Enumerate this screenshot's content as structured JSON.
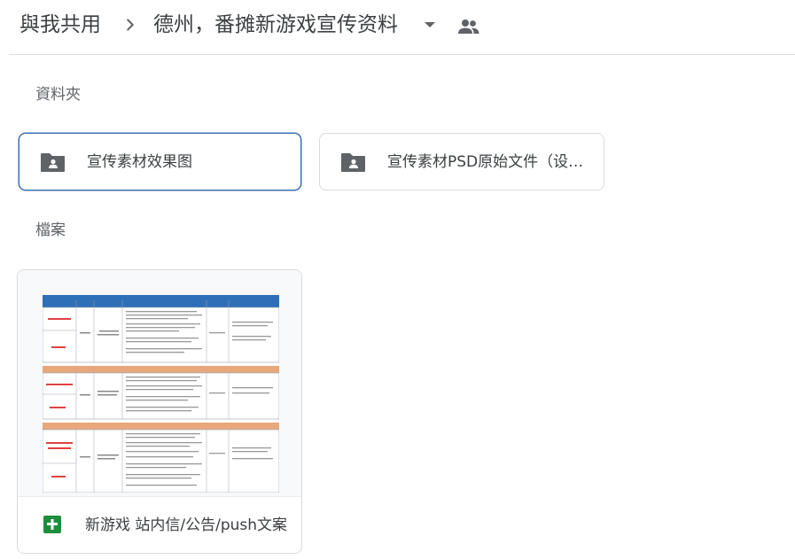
{
  "breadcrumb": {
    "root": "與我共用",
    "current": "德州，番摊新游戏宣传资料"
  },
  "icons": {
    "separator": "chevron-right-icon",
    "caret": "caret-down-icon",
    "shared": "people-icon",
    "folder": "shared-folder-icon",
    "file": "google-sheets-icon"
  },
  "sections": {
    "folders_label": "資料夾",
    "files_label": "檔案"
  },
  "folders": [
    {
      "name": "宣传素材效果图",
      "selected": true
    },
    {
      "name": "宣传素材PSD原始文件（设计师专用）",
      "selected": false
    }
  ],
  "files": [
    {
      "name": "新游戏 站内信/公告/push文案",
      "type": "spreadsheet"
    }
  ],
  "colors": {
    "selected_border": "#3b6fb0",
    "sheet_blue_header": "#2f6fb7",
    "sheet_orange_header": "#e8a87c",
    "sheets_green": "#1e8e3e",
    "icon_gray": "#5f6368"
  }
}
